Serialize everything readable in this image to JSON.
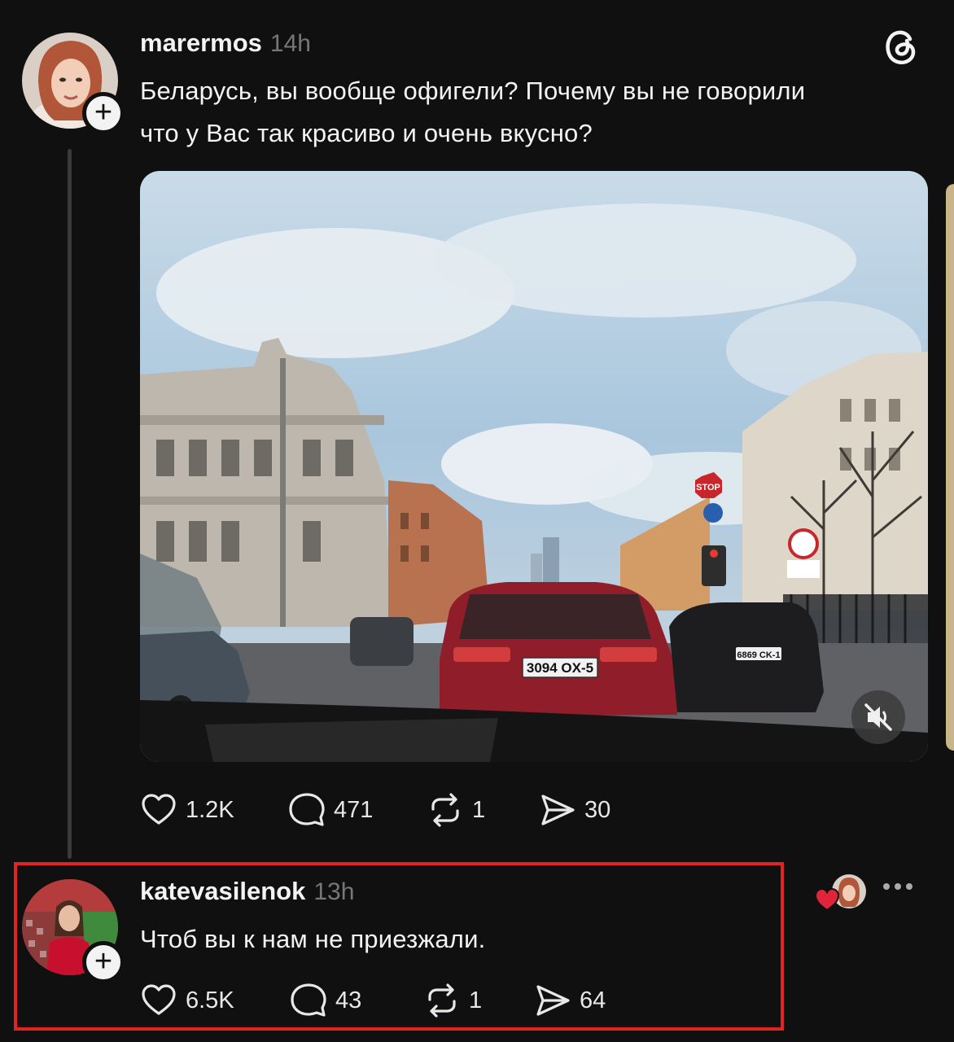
{
  "post": {
    "username": "marermos",
    "time": "14h",
    "text_line1": "Беларусь, вы вообще офигели? Почему вы не говорили",
    "text_line2": "что у Вас так красиво и очень вкусно?",
    "media": {
      "plate_front": "3094 OX-5",
      "plate_right": "6869 CK-1",
      "stop_sign": "STOP"
    },
    "stats": {
      "likes": "1.2K",
      "replies": "471",
      "reposts": "1",
      "shares": "30"
    }
  },
  "reply": {
    "username": "katevasilenok",
    "time": "13h",
    "text": "Чтоб вы к нам не приезжали.",
    "stats": {
      "likes": "6.5K",
      "replies": "43",
      "reposts": "1",
      "shares": "64"
    }
  },
  "icons": {
    "app": "threads-logo-icon",
    "follow": "plus-icon",
    "like": "heart-icon",
    "reply": "comment-icon",
    "repost": "repost-icon",
    "share": "send-icon",
    "mute": "speaker-muted-icon",
    "more": "more-dots-icon"
  },
  "colors": {
    "background": "#101010",
    "highlight": "#e32222",
    "liked": "#e0243a"
  }
}
